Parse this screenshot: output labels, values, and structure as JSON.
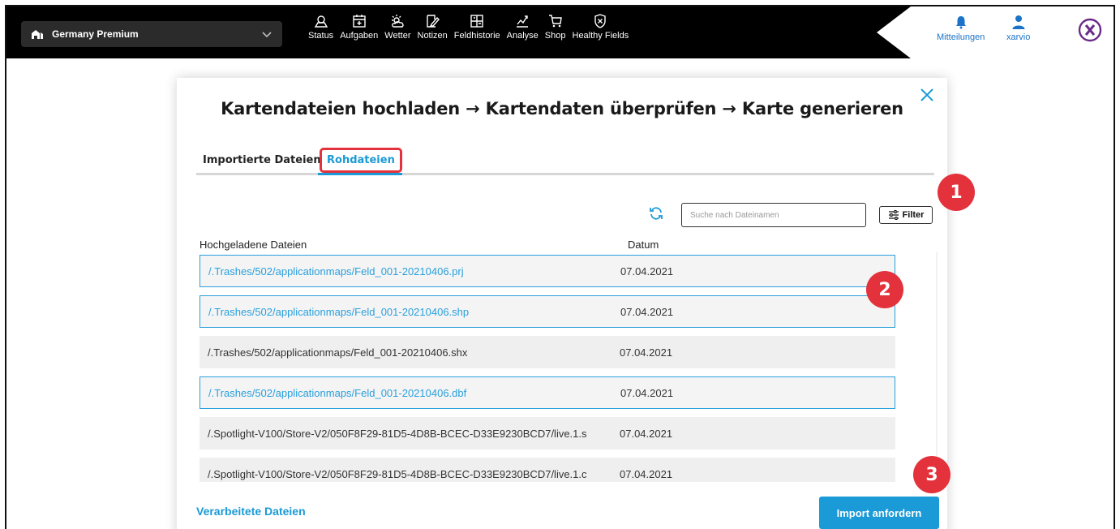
{
  "topbar": {
    "farm_name": "Germany Premium",
    "nav": [
      {
        "label": "Status",
        "icon": "status-icon"
      },
      {
        "label": "Aufgaben",
        "icon": "calendar-icon"
      },
      {
        "label": "Wetter",
        "icon": "weather-icon"
      },
      {
        "label": "Notizen",
        "icon": "notes-icon"
      },
      {
        "label": "Feldhistorie",
        "icon": "field-history-icon"
      },
      {
        "label": "Analyse",
        "icon": "analysis-icon"
      },
      {
        "label": "Shop",
        "icon": "cart-icon"
      },
      {
        "label": "Healthy Fields",
        "icon": "healthy-fields-icon"
      }
    ],
    "notifications_label": "Mitteilungen",
    "user_label": "xarvio"
  },
  "modal": {
    "title": "Kartendateien hochladen → Kartendaten überprüfen → Karte generieren",
    "tabs": [
      {
        "label": "Importierte Dateien",
        "active": false
      },
      {
        "label": "Rohdateien",
        "active": true
      }
    ],
    "search_placeholder": "Suche nach Dateinamen",
    "filter_label": "Filter",
    "columns": {
      "files": "Hochgeladene Dateien",
      "date": "Datum"
    },
    "rows": [
      {
        "name": "/.Trashes/502/applicationmaps/Feld_001-20210406.prj",
        "date": "07.04.2021",
        "selected": true
      },
      {
        "name": "/.Trashes/502/applicationmaps/Feld_001-20210406.shp",
        "date": "07.04.2021",
        "selected": true
      },
      {
        "name": "/.Trashes/502/applicationmaps/Feld_001-20210406.shx",
        "date": "07.04.2021",
        "selected": false
      },
      {
        "name": "/.Trashes/502/applicationmaps/Feld_001-20210406.dbf",
        "date": "07.04.2021",
        "selected": true
      },
      {
        "name": "/.Spotlight-V100/Store-V2/050F8F29-81D5-4D8B-BCEC-D33E9230BCD7/live.1.s",
        "date": "07.04.2021",
        "selected": false
      },
      {
        "name": "/.Spotlight-V100/Store-V2/050F8F29-81D5-4D8B-BCEC-D33E9230BCD7/live.1.c",
        "date": "07.04.2021",
        "selected": false
      }
    ],
    "processed_link": "Verarbeitete Dateien",
    "import_button": "Import anfordern"
  },
  "annotations": {
    "badge_1": "1",
    "badge_2": "2",
    "badge_3": "3"
  },
  "colors": {
    "accent": "#1a9ad6",
    "highlight": "#e3323b",
    "topbar": "#000000"
  }
}
